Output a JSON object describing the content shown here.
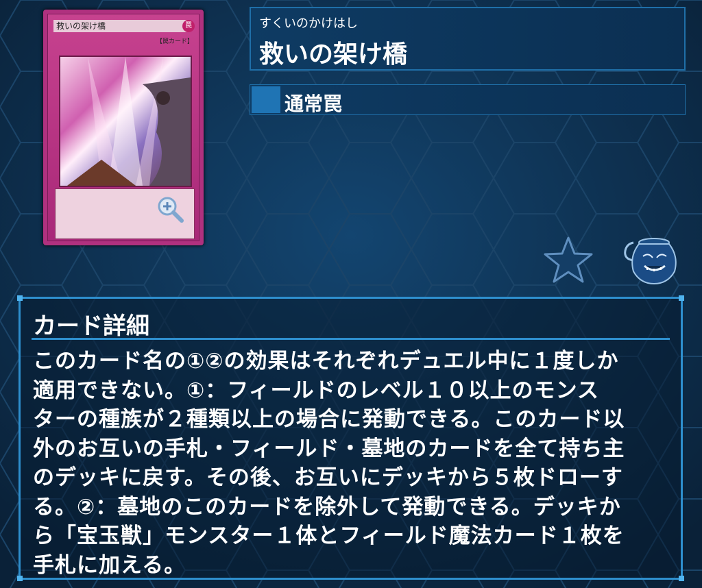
{
  "card": {
    "art_name": "救いの架け橋",
    "art_attribute": "罠",
    "art_type_line": "【罠カード】"
  },
  "header": {
    "ruby": "すくいのかけはし",
    "name": "救いの架け橋"
  },
  "type": {
    "label": "通常罠"
  },
  "icons": {
    "favorite": "star-icon",
    "pot": "pot-of-greed-icon",
    "zoom": "zoom-in-icon"
  },
  "detail": {
    "title": "カード詳細",
    "text": "このカード名の①②の効果はそれぞれデュエル中に１度しか\n適用できない。①：フィールドのレベル１０以上のモンス\nターの種族が２種類以上の場合に発動できる。このカード以\n外のお互いの手札・フィールド・墓地のカードを全て持ち主\nのデッキに戻す。その後、お互いにデッキから５枚ドローす\nる。②：墓地のこのカードを除外して発動できる。デッキか\nら「宝玉獣」モンスター１体とフィールド魔法カード１枚を\n手札に加える。"
  },
  "colors": {
    "background": "#0d2a45",
    "accent": "#2e8fce",
    "trap_card": "#b0317f"
  }
}
